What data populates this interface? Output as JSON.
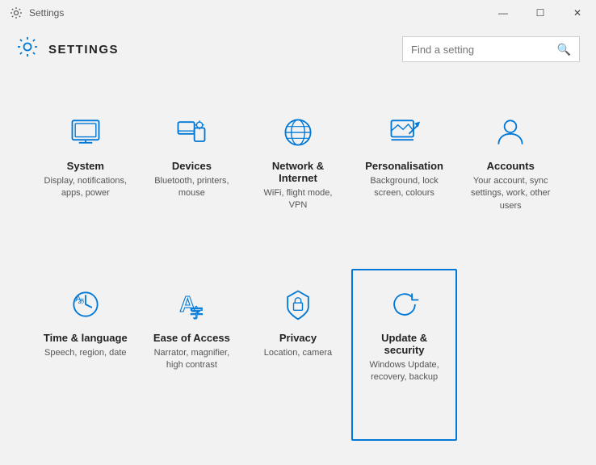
{
  "window": {
    "title": "Settings",
    "controls": {
      "minimize": "—",
      "maximize": "☐",
      "close": "✕"
    }
  },
  "header": {
    "title": "SETTINGS",
    "search_placeholder": "Find a setting"
  },
  "grid": {
    "items": [
      {
        "name": "System",
        "desc": "Display, notifications, apps, power",
        "icon": "system"
      },
      {
        "name": "Devices",
        "desc": "Bluetooth, printers, mouse",
        "icon": "devices"
      },
      {
        "name": "Network & Internet",
        "desc": "WiFi, flight mode, VPN",
        "icon": "network"
      },
      {
        "name": "Personalisation",
        "desc": "Background, lock screen, colours",
        "icon": "personalisation"
      },
      {
        "name": "Accounts",
        "desc": "Your account, sync settings, work, other users",
        "icon": "accounts"
      },
      {
        "name": "Time & language",
        "desc": "Speech, region, date",
        "icon": "time"
      },
      {
        "name": "Ease of Access",
        "desc": "Narrator, magnifier, high contrast",
        "icon": "ease"
      },
      {
        "name": "Privacy",
        "desc": "Location, camera",
        "icon": "privacy"
      },
      {
        "name": "Update & security",
        "desc": "Windows Update, recovery, backup",
        "icon": "update",
        "active": true
      }
    ]
  }
}
